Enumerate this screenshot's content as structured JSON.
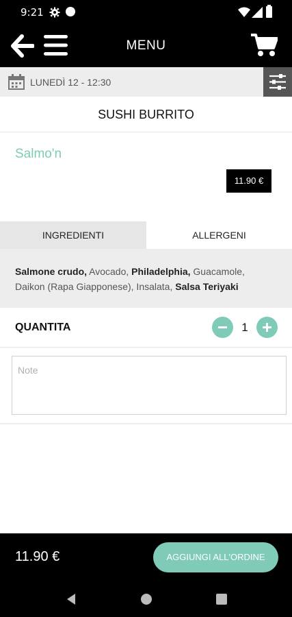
{
  "status_bar": {
    "time": "9:21",
    "icons": [
      "gear-icon",
      "circle-icon",
      "wifi-icon",
      "signal-icon",
      "battery-icon"
    ]
  },
  "app_bar": {
    "title": "MENU",
    "icons": [
      "back-arrow-icon",
      "menu-icon",
      "cart-icon"
    ]
  },
  "date_bar": {
    "date": "LUNEDÌ 12 - 12:30",
    "icons": [
      "calendar-icon",
      "filter-sliders-icon"
    ]
  },
  "product": {
    "title": "SUSHI BURRITO",
    "name": "Salmo'n",
    "price": "11.90 €"
  },
  "tabs": [
    {
      "label": "INGREDIENTI",
      "active": true
    },
    {
      "label": "ALLERGENI",
      "active": false
    }
  ],
  "ingredients": [
    {
      "text": "Salmone crudo,",
      "bold": true
    },
    {
      "text": " Avocado, ",
      "bold": false
    },
    {
      "text": "Philadelphia,",
      "bold": true
    },
    {
      "text": " Guacamole, Daikon (Rapa Giapponese), Insalata, ",
      "bold": false
    },
    {
      "text": "Salsa Teriyaki",
      "bold": true
    }
  ],
  "quantity": {
    "label": "QUANTITA",
    "value": "1",
    "icons": [
      "minus-icon",
      "plus-icon"
    ]
  },
  "note": {
    "placeholder": "Note",
    "value": ""
  },
  "footer": {
    "total": "11.90 €",
    "add_label": "AGGIUNGI ALL'ORDINE"
  },
  "nav_bar": {
    "icons": [
      "nav-back-icon",
      "nav-home-icon",
      "nav-recents-icon"
    ]
  },
  "colors": {
    "accent": "#7fcbb7",
    "dark": "#000000",
    "light_gray": "#ededed"
  }
}
